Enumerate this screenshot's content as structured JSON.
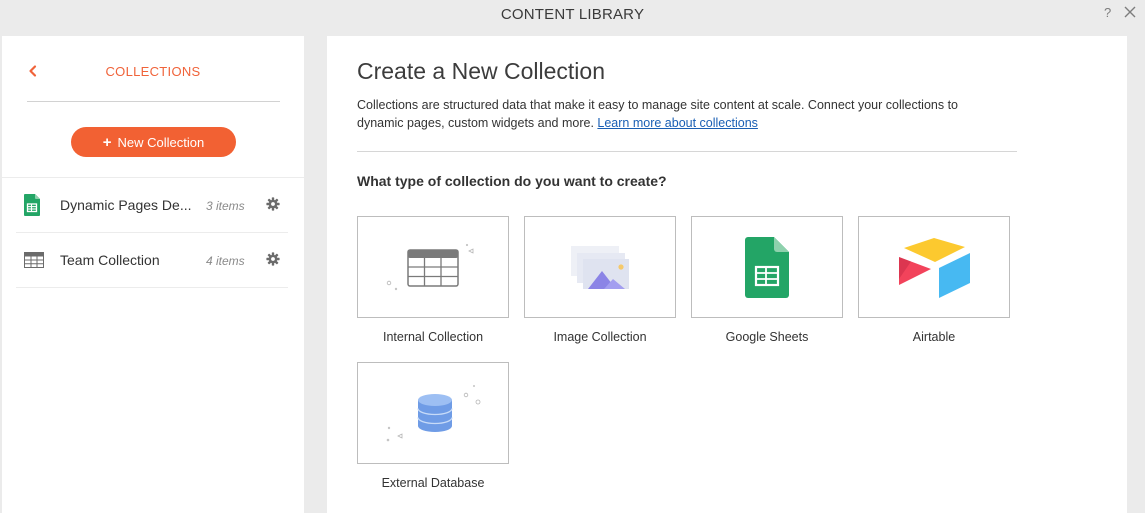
{
  "window": {
    "title": "CONTENT LIBRARY",
    "help_label": "?",
    "close_icon": "close-icon"
  },
  "sidebar": {
    "back_icon": "chevron-left-icon",
    "title": "COLLECTIONS",
    "new_button_plus": "+",
    "new_button_label": "New Collection",
    "items": [
      {
        "name": "Dynamic Pages De...",
        "count": "3 items",
        "icon": "google-sheets-icon"
      },
      {
        "name": "Team Collection",
        "count": "4 items",
        "icon": "table-icon"
      }
    ]
  },
  "main": {
    "title": "Create a New Collection",
    "description": "Collections are structured data that make it easy to manage site content at scale. Connect your collections to dynamic pages, custom widgets and more.",
    "learn_more": "Learn more about collections",
    "question": "What type of collection do you want to create?",
    "options": [
      {
        "label": "Internal Collection",
        "icon": "table-grid-icon"
      },
      {
        "label": "Image Collection",
        "icon": "image-stack-icon"
      },
      {
        "label": "Google Sheets",
        "icon": "google-sheets-icon"
      },
      {
        "label": "Airtable",
        "icon": "airtable-icon"
      },
      {
        "label": "External Database",
        "icon": "database-icon"
      }
    ]
  },
  "colors": {
    "accent": "#f26133",
    "link": "#1a5fb4",
    "sheets_green": "#23a566",
    "background": "#ebebeb"
  }
}
